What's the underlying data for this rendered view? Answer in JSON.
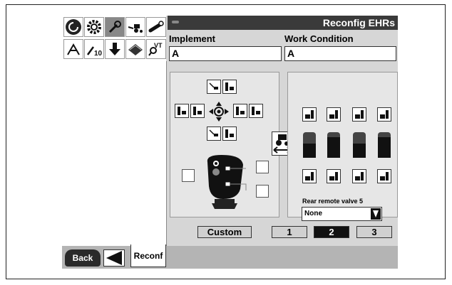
{
  "window": {
    "title": "Reconfig EHRs"
  },
  "fields": {
    "implement": {
      "label": "Implement",
      "value": "A"
    },
    "work_condition": {
      "label": "Work Condition",
      "value": "A"
    }
  },
  "toolbar_icons": [
    "swirl-logo-icon",
    "gear-icon",
    "wrench-icon",
    "tractor-implement-icon",
    "rotary-knob-icon",
    "hitch-icon",
    "wrench-10-icon",
    "arrow-down-icon",
    "book-icon",
    "vt-search-icon"
  ],
  "remote": {
    "label": "Rear remote valve 5",
    "selected": "None"
  },
  "bar_levels": [
    0.55,
    0.8,
    0.55,
    0.8
  ],
  "buttons": {
    "custom": "Custom",
    "pages": [
      "1",
      "2",
      "3"
    ],
    "active_page": "2"
  },
  "nav": {
    "back": "Back",
    "reconf": "Reconf"
  }
}
